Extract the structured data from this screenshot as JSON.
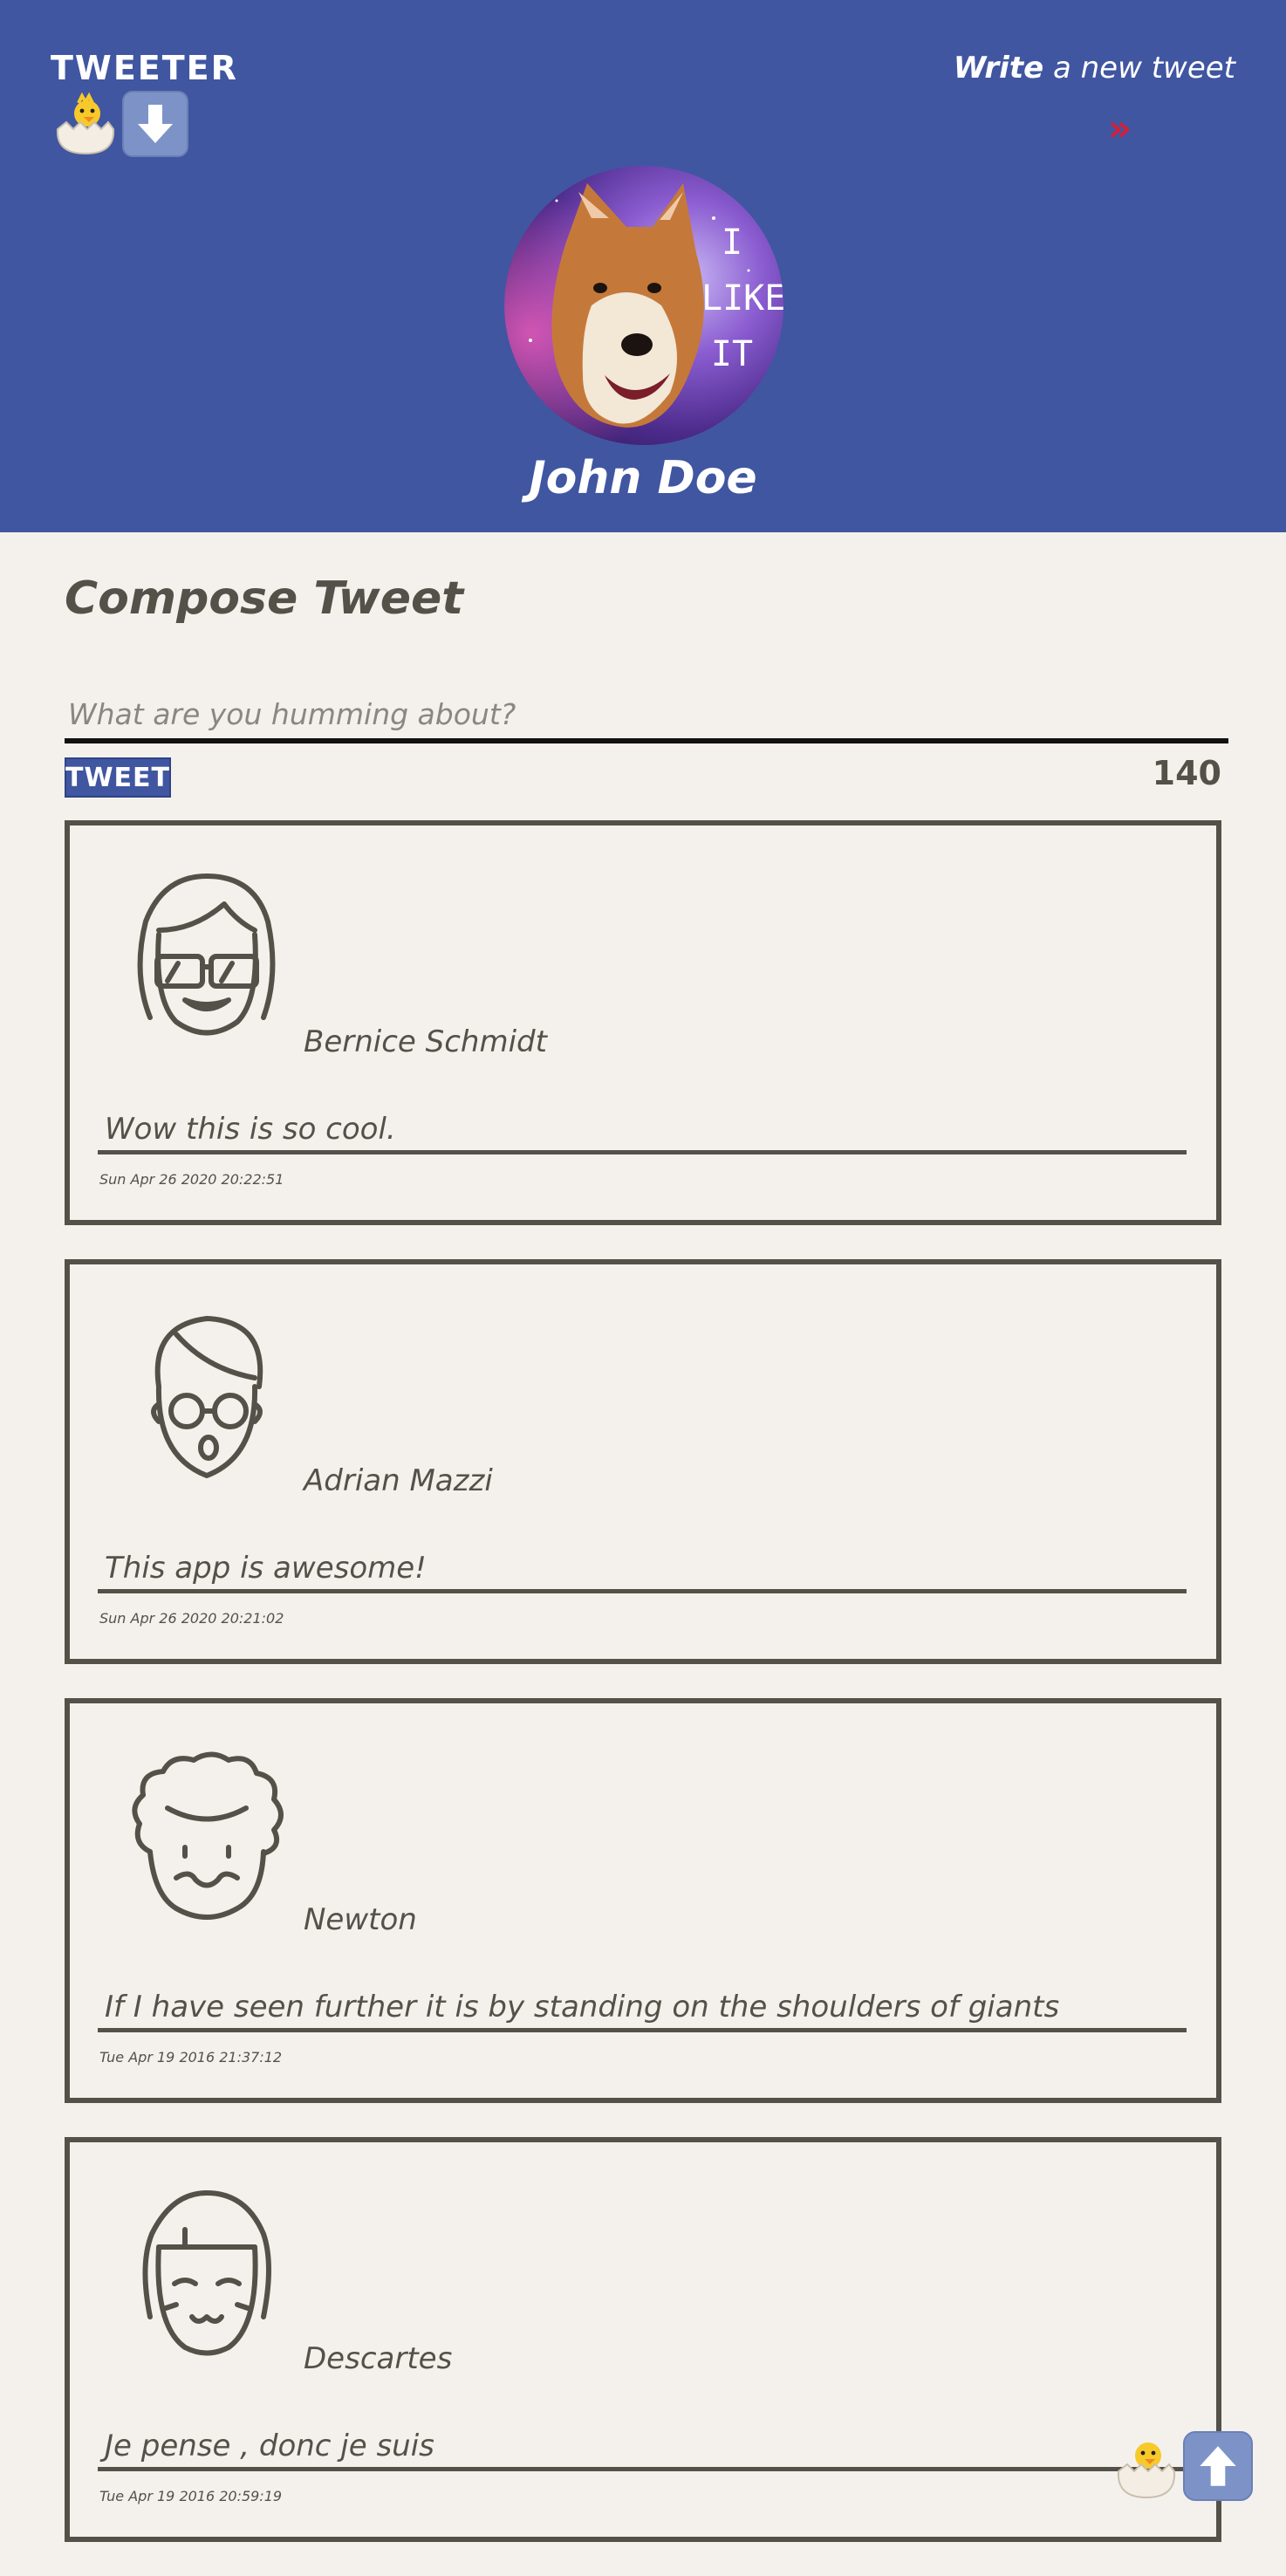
{
  "header": {
    "brand": "TWEETER",
    "nav_write_strong": "Write",
    "nav_write_rest": " a new tweet",
    "nav_arrow": "»",
    "user_name": "John Doe",
    "avatar_caption": [
      "I",
      "LIKE",
      "IT"
    ]
  },
  "compose": {
    "title": "Compose Tweet",
    "placeholder": "What are you humming about?",
    "button_label": "TWEET",
    "counter": "140"
  },
  "tweets": [
    {
      "author": "Bernice Schmidt",
      "content": "Wow this is so cool.",
      "time": "Sun Apr 26 2020 20:22:51",
      "avatar": "girl-sunglasses-avatar-icon"
    },
    {
      "author": "Adrian Mazzi",
      "content": "This app is awesome!",
      "time": "Sun Apr 26 2020 20:21:02",
      "avatar": "boy-glasses-avatar-icon"
    },
    {
      "author": "Newton",
      "content": "If I have seen further it is by standing on the shoulders of giants",
      "time": "Tue Apr 19 2016 21:37:12",
      "avatar": "curly-hair-avatar-icon"
    },
    {
      "author": "Descartes",
      "content": "Je pense , donc je suis",
      "time": "Tue Apr 19 2016 20:59:19",
      "avatar": "bob-hair-avatar-icon"
    }
  ],
  "colors": {
    "header": "#4056a1",
    "page": "#f4f1ed",
    "ink": "#545149",
    "arrow": "#d21f3c"
  },
  "icons": [
    "hatching-chick-icon",
    "down-arrow-icon",
    "up-arrow-icon"
  ]
}
